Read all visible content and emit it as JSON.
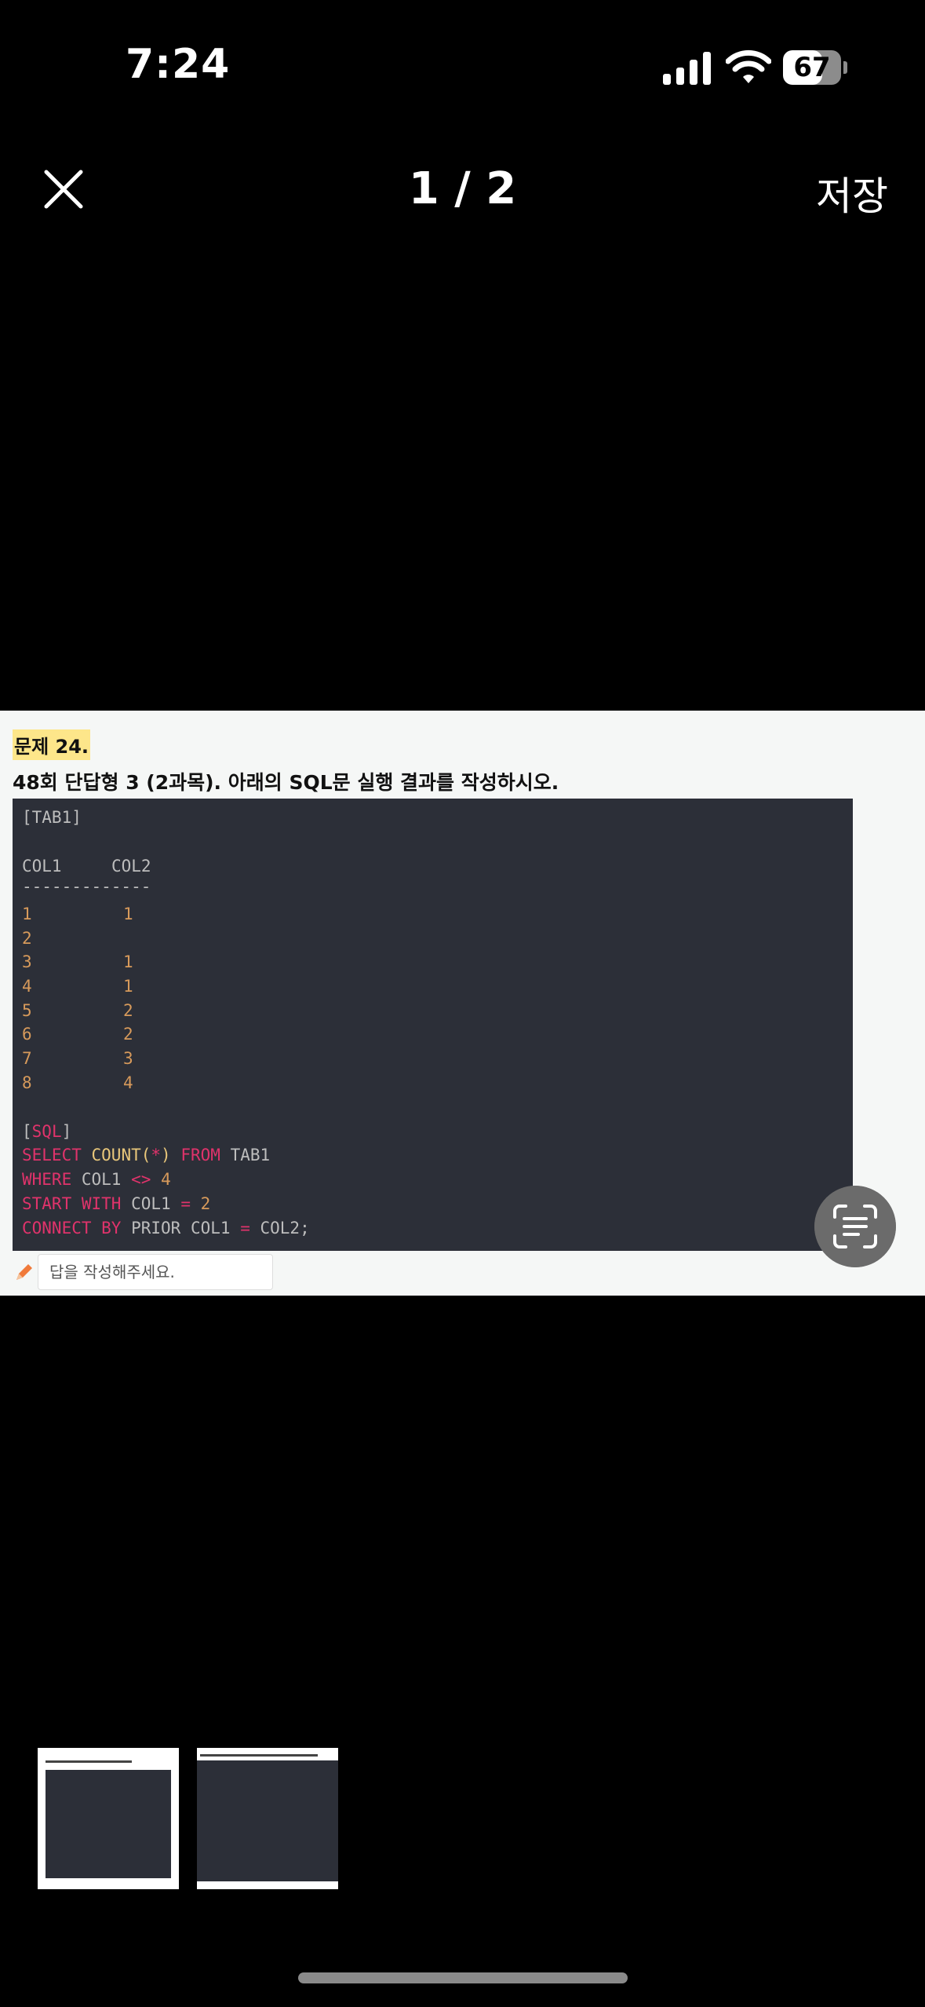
{
  "status": {
    "time": "7:24",
    "battery": "67",
    "battery_level": 0.67
  },
  "header": {
    "pager": "1 / 2",
    "save_label": "저장",
    "close_icon": "close-icon"
  },
  "document": {
    "question_number": "문제 24.",
    "question_title": "48회 단답형 3 (2과목). 아래의 SQL문 실행 결과를 작성하시오.",
    "code": {
      "table_tag": "[TAB1]",
      "col1_header": "COL1",
      "col2_header": "COL2",
      "separator": "-------------",
      "rows": [
        {
          "col1": "1",
          "col2": "1"
        },
        {
          "col1": "2",
          "col2": ""
        },
        {
          "col1": "3",
          "col2": "1"
        },
        {
          "col1": "4",
          "col2": "1"
        },
        {
          "col1": "5",
          "col2": "2"
        },
        {
          "col1": "6",
          "col2": "2"
        },
        {
          "col1": "7",
          "col2": "3"
        },
        {
          "col1": "8",
          "col2": "4"
        }
      ],
      "sql_tag_open": "[",
      "sql_tag": "SQL",
      "sql_tag_close": "]",
      "line1": {
        "kw1": "SELECT",
        "fn": "COUNT",
        "paren_open": "(",
        "star": "*",
        "paren_close": ")",
        "kw2": "FROM",
        "table": "TAB1"
      },
      "line2": {
        "kw": "WHERE",
        "col": "COL1",
        "op": "<>",
        "val": "4"
      },
      "line3": {
        "kw": "START WITH",
        "col": "COL1",
        "op": "=",
        "val": "2"
      },
      "line4": {
        "kw": "CONNECT BY",
        "rest": "PRIOR COL1",
        "op": "=",
        "col": "COL2;"
      }
    },
    "answer_placeholder": "답을 작성해주세요."
  }
}
